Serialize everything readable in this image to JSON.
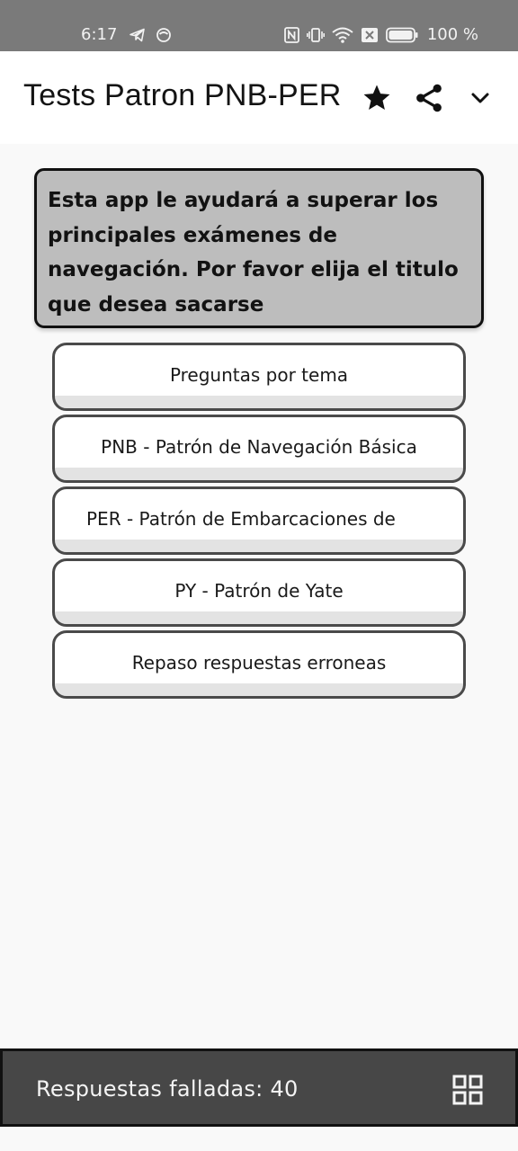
{
  "status_bar": {
    "time": "6:17",
    "battery": "100 %",
    "left_icons": [
      "telegram-icon",
      "app-notification-icon"
    ],
    "right_icons": [
      "nfc-icon",
      "vibrate-icon",
      "wifi-icon",
      "sim-off-icon",
      "battery-icon"
    ]
  },
  "app_bar": {
    "title": "Tests Patron PNB-PER",
    "actions": [
      "star-icon",
      "share-icon",
      "chevron-down-icon"
    ]
  },
  "intro": {
    "text": "Esta app le ayudará a superar los principales exámenes de navegación. Por favor elija el titulo que desea sacarse"
  },
  "menu": {
    "buttons": [
      {
        "label": "Preguntas por tema"
      },
      {
        "label": "PNB - Patrón de Navegación Básica"
      },
      {
        "label": "PER - Patrón de Embarcaciones de"
      },
      {
        "label": "PY - Patrón de Yate"
      },
      {
        "label": "Repaso respuestas erroneas"
      }
    ]
  },
  "bottom_bar": {
    "text": "Respuestas falladas: 40",
    "icon": "grid-icon"
  },
  "colors": {
    "status_bar": "#7a7a7a",
    "app_bar": "#ffffff",
    "background": "#f9f9f9",
    "intro_box": "#bdbdbd",
    "bottom_bar": "#474747",
    "button_border": "#4a4a4a"
  }
}
